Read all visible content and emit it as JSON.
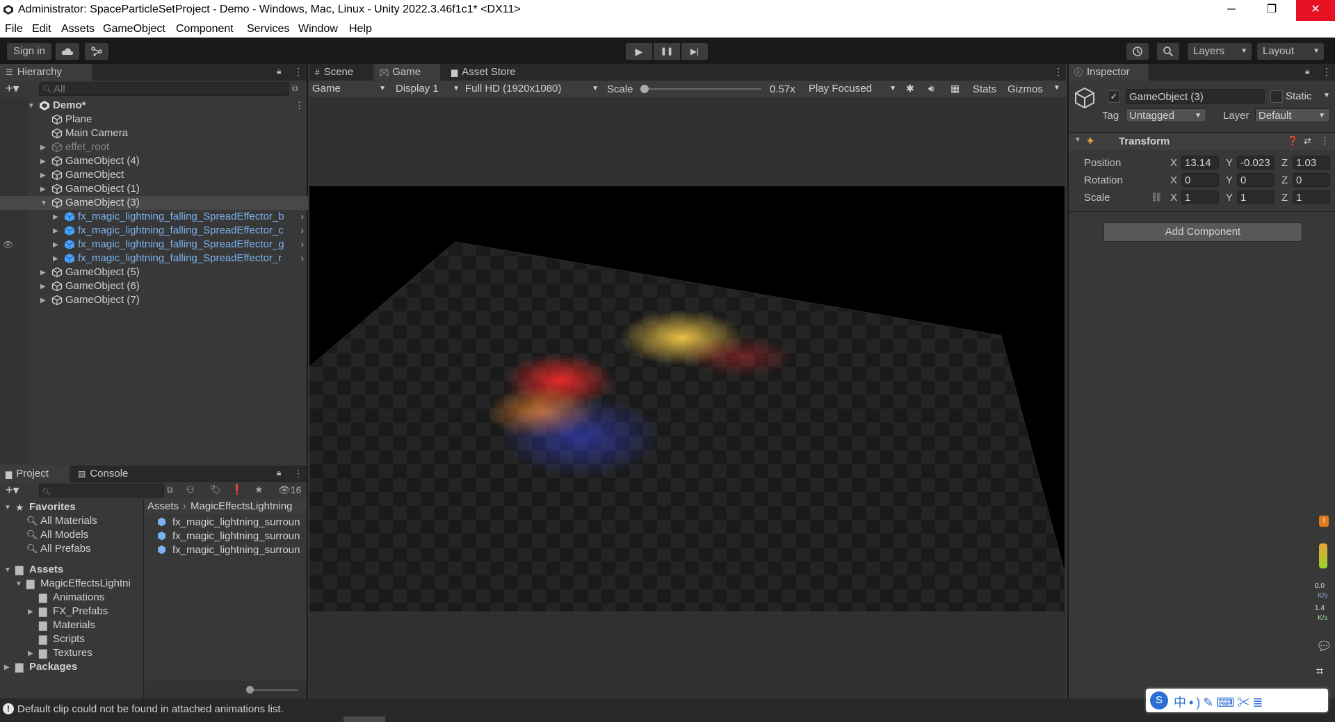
{
  "window": {
    "title": "Administrator: SpaceParticleSetProject - Demo - Windows, Mac, Linux - Unity 2022.3.46f1c1* <DX11>",
    "minimize": "─",
    "restore": "❐",
    "close": "✕"
  },
  "menu": [
    "File",
    "Edit",
    "Assets",
    "GameObject",
    "Component",
    "Services",
    "Window",
    "Help"
  ],
  "toolbar": {
    "sign_in": "Sign in",
    "cloud_icon": "cloud-icon",
    "collab_icon": "collab-icon",
    "play": "▶",
    "pause": "❚❚",
    "step": "▶|",
    "history_icon": "history-icon",
    "search_icon": "search-icon",
    "layers": "Layers",
    "layout": "Layout"
  },
  "hierarchy": {
    "tab": "Hierarchy",
    "search_placeholder": "All",
    "rows": [
      {
        "label": "Demo*",
        "kind": "scene"
      },
      {
        "label": "Plane",
        "kind": "go"
      },
      {
        "label": "Main Camera",
        "kind": "go"
      },
      {
        "label": "effet_root",
        "kind": "dim"
      },
      {
        "label": "GameObject (4)",
        "kind": "go"
      },
      {
        "label": "GameObject",
        "kind": "go"
      },
      {
        "label": "GameObject (1)",
        "kind": "go"
      },
      {
        "label": "GameObject (3)",
        "kind": "sel"
      },
      {
        "label": "fx_magic_lightning_falling_SpreadEffector_b",
        "kind": "prefab"
      },
      {
        "label": "fx_magic_lightning_falling_SpreadEffector_c",
        "kind": "prefab"
      },
      {
        "label": "fx_magic_lightning_falling_SpreadEffector_g",
        "kind": "prefab"
      },
      {
        "label": "fx_magic_lightning_falling_SpreadEffector_r",
        "kind": "prefab"
      },
      {
        "label": "GameObject (5)",
        "kind": "go"
      },
      {
        "label": "GameObject (6)",
        "kind": "go"
      },
      {
        "label": "GameObject (7)",
        "kind": "go"
      }
    ]
  },
  "project": {
    "tab_project": "Project",
    "tab_console": "Console",
    "hidden_count": "16",
    "favorites": "Favorites",
    "fav_items": [
      "All Materials",
      "All Models",
      "All Prefabs"
    ],
    "assets": "Assets",
    "folder_root": "MagicEffectsLightni",
    "folders": [
      "Animations",
      "FX_Prefabs",
      "Materials",
      "Scripts",
      "Textures"
    ],
    "packages": "Packages",
    "breadcrumb": [
      "Assets",
      "MagicEffectsLightning"
    ],
    "files": [
      "fx_magic_lightning_surroun",
      "fx_magic_lightning_surroun",
      "fx_magic_lightning_surroun"
    ]
  },
  "game": {
    "tab_scene": "Scene",
    "tab_game": "Game",
    "tab_store": "Asset Store",
    "view_mode": "Game",
    "display": "Display 1",
    "resolution": "Full HD (1920x1080)",
    "scale_label": "Scale",
    "scale_value": "0.57x",
    "scale_fraction": 0.0,
    "play_focused": "Play Focused",
    "stats": "Stats",
    "gizmos": "Gizmos"
  },
  "inspector": {
    "tab": "Inspector",
    "object_name": "GameObject (3)",
    "static": "Static",
    "tag_label": "Tag",
    "tag_value": "Untagged",
    "layer_label": "Layer",
    "layer_value": "Default",
    "component": "Transform",
    "position_label": "Position",
    "rotation_label": "Rotation",
    "scale_label": "Scale",
    "position": {
      "x": "13.14",
      "y": "-0.023",
      "z": "1.03"
    },
    "rotation": {
      "x": "0",
      "y": "0",
      "z": "0"
    },
    "scale": {
      "x": "1",
      "y": "1",
      "z": "1"
    },
    "axis": {
      "x": "X",
      "y": "Y",
      "z": "Z"
    },
    "add_component": "Add Component"
  },
  "side": {
    "net_up": "0.0",
    "net_up_unit": "K/s",
    "net_down": "1.4",
    "net_down_unit": "K/s"
  },
  "status": {
    "message": "Default clip could not be found in attached animations list."
  },
  "colors": {
    "selection": "#484848",
    "prefab_text": "#7bb2ef",
    "close_red": "#e81123"
  }
}
